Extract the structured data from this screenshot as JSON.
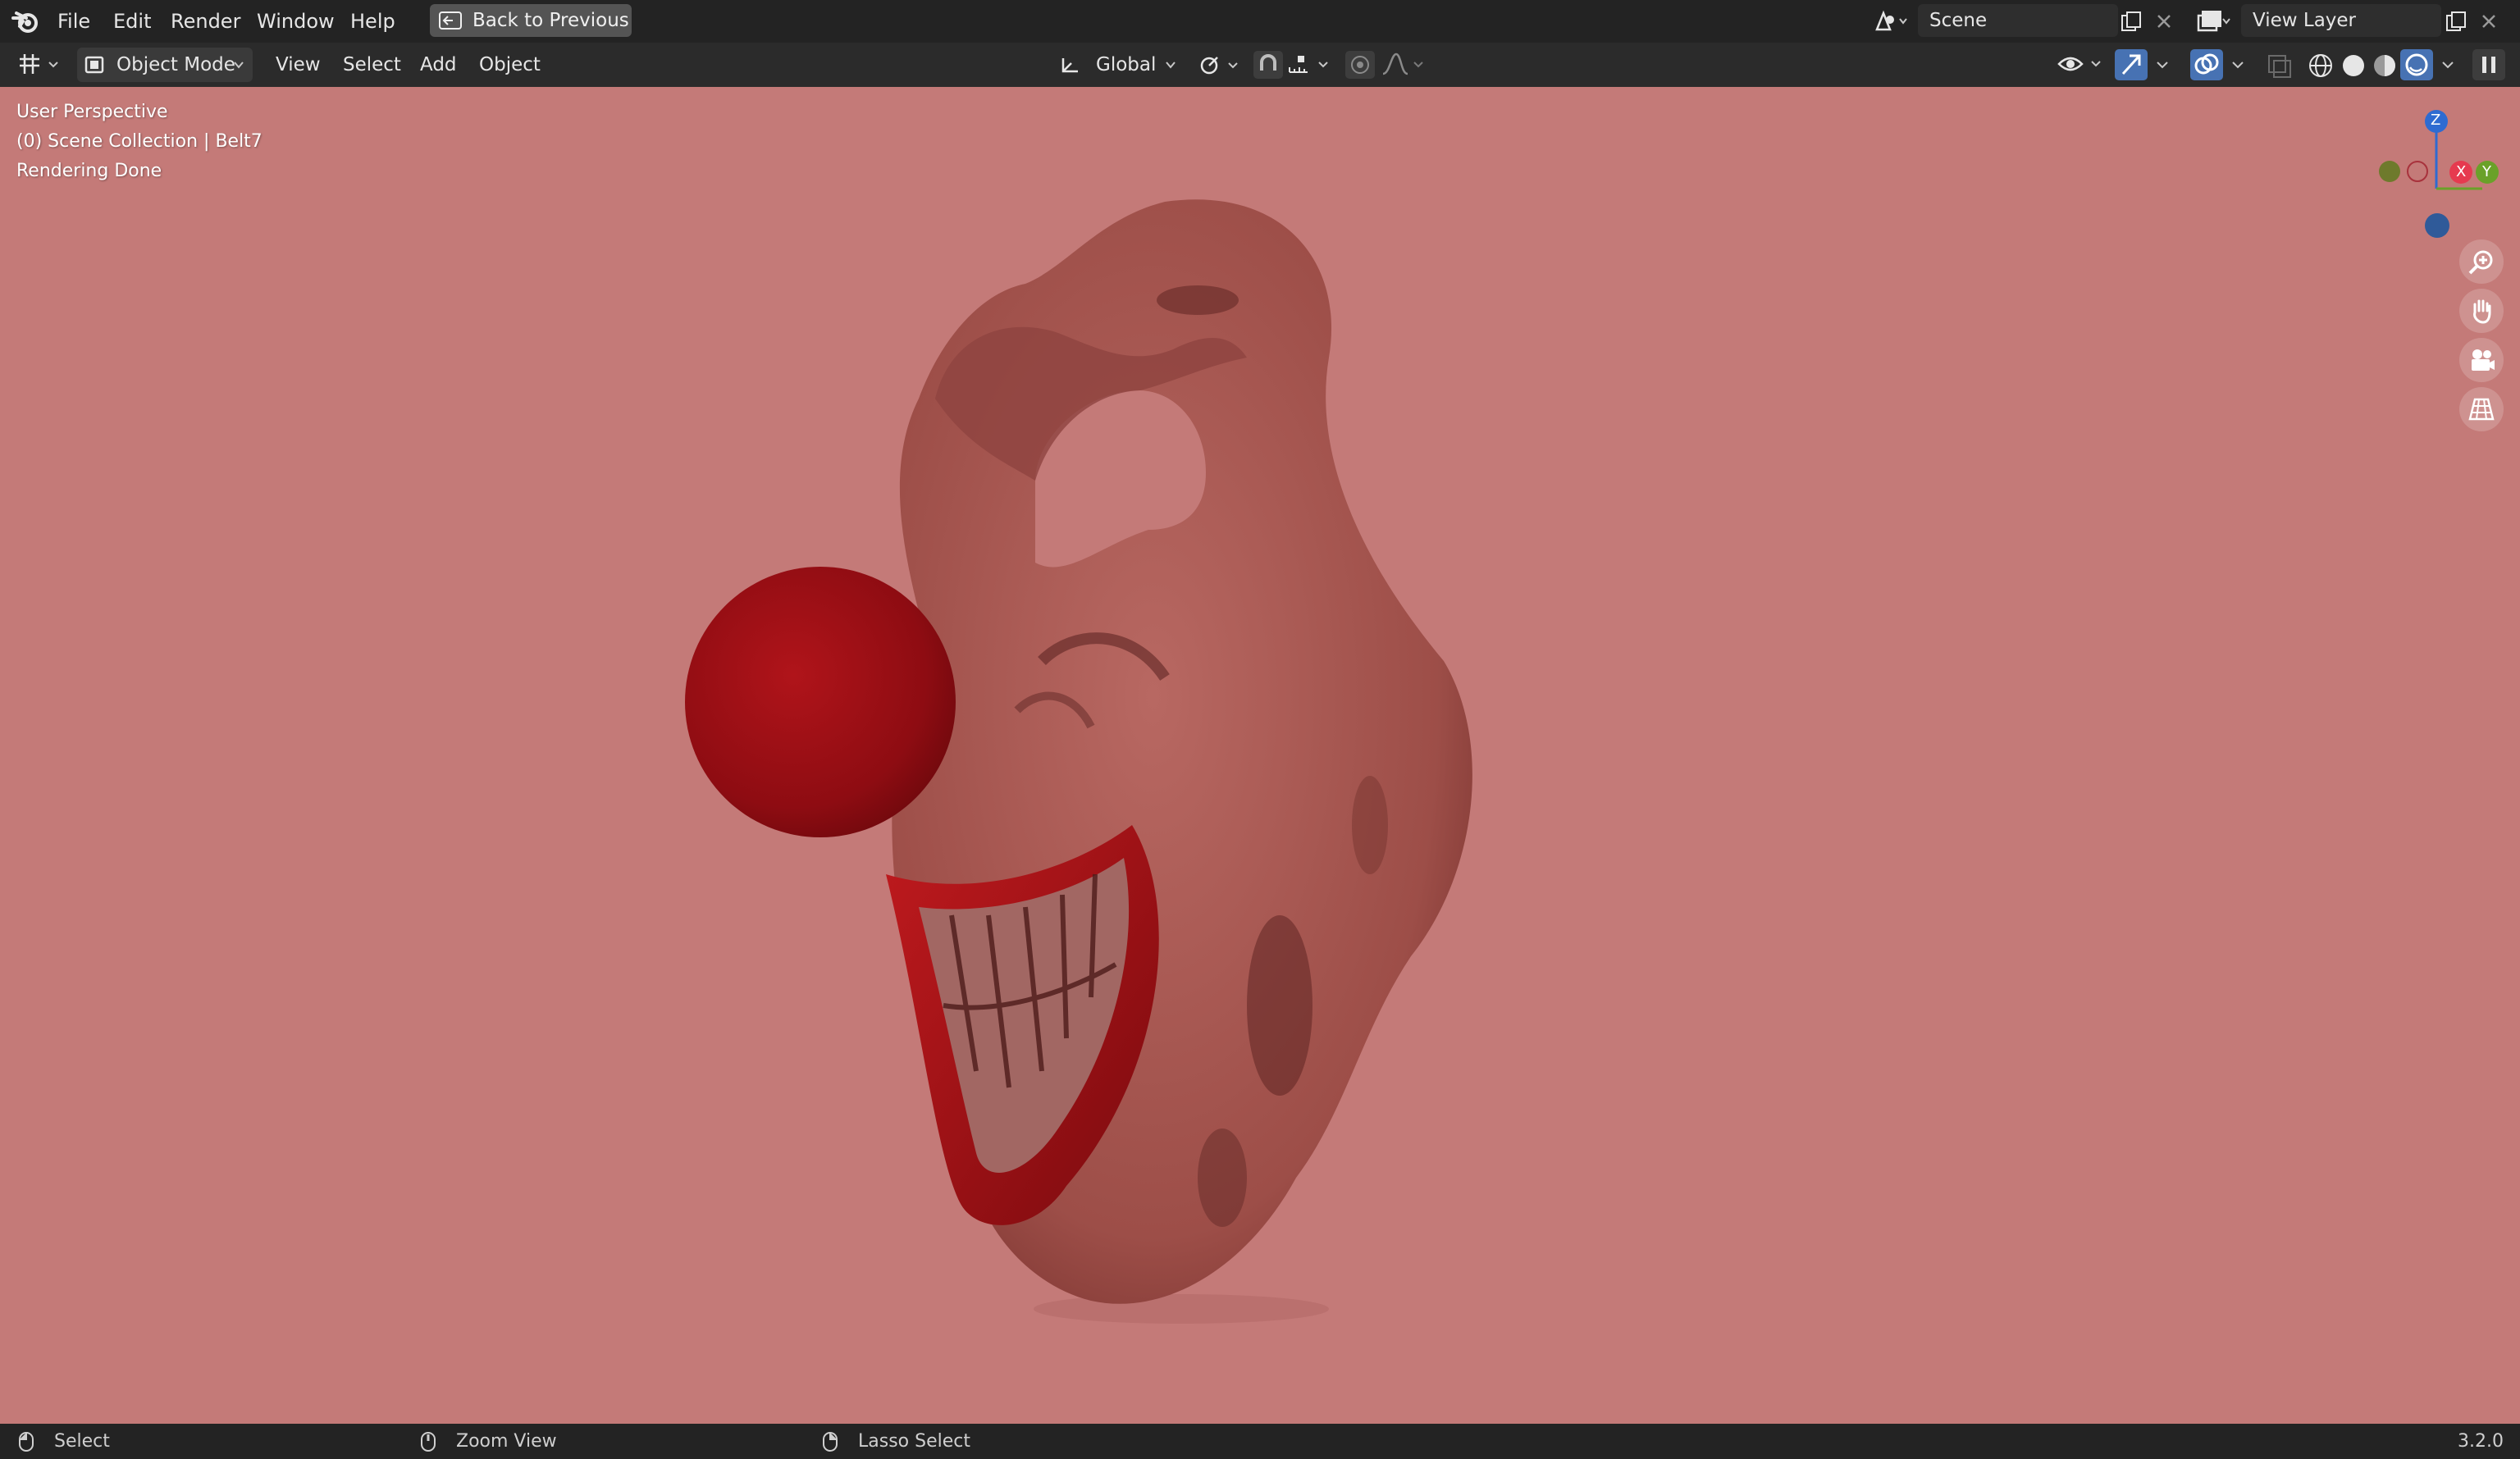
{
  "topbar": {
    "menus": [
      "File",
      "Edit",
      "Render",
      "Window",
      "Help"
    ],
    "back_button": "Back to Previous",
    "scene_name": "Scene",
    "view_layer": "View Layer"
  },
  "header": {
    "mode": "Object Mode",
    "menus": [
      "View",
      "Select",
      "Add",
      "Object"
    ],
    "transform_orientation": "Global"
  },
  "viewport": {
    "overlay": {
      "perspective": "User Perspective",
      "collection": "(0) Scene Collection | Belt7",
      "status": "Rendering Done"
    },
    "gizmo": {
      "z": "Z",
      "x": "X",
      "y": "Y"
    },
    "background_color": "#c47a78",
    "nav_icons": [
      "zoom-in-icon",
      "pan-hand-icon",
      "camera-icon",
      "grid-view-icon"
    ]
  },
  "statusbar": {
    "items": [
      "Select",
      "Zoom View",
      "Lasso Select"
    ],
    "version": "3.2.0"
  },
  "colors": {
    "topbar": "#232323",
    "header": "#2b2b2b",
    "accent_blue": "#4772b3",
    "axis_x": "#e63a4f",
    "axis_y": "#6aa129",
    "axis_z": "#2e6bd1"
  }
}
